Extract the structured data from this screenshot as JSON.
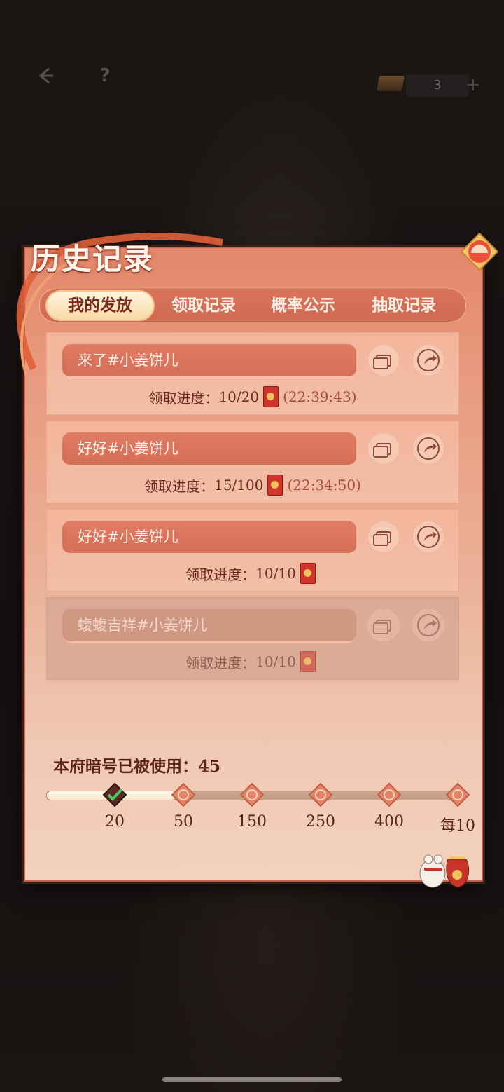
{
  "hud": {
    "resource_count": "3",
    "plus_label": "+"
  },
  "panel": {
    "title": "历史记录"
  },
  "tabs": [
    {
      "label": "我的发放",
      "active": true
    },
    {
      "label": "领取记录",
      "active": false
    },
    {
      "label": "概率公示",
      "active": false
    },
    {
      "label": "抽取记录",
      "active": false
    }
  ],
  "records": [
    {
      "name": "来了#小姜饼儿",
      "progress_label": "领取进度：",
      "progress": "10/20",
      "time": "(22:39:43)",
      "dimmed": false
    },
    {
      "name": "好好#小姜饼儿",
      "progress_label": "领取进度：",
      "progress": "15/100",
      "time": "(22:34:50)",
      "dimmed": false
    },
    {
      "name": "好好#小姜饼儿",
      "progress_label": "领取进度：",
      "progress": "10/10",
      "time": "",
      "dimmed": false
    },
    {
      "name": "蝮蝮吉祥#小姜饼儿",
      "progress_label": "领取进度：",
      "progress": "10/10",
      "time": "",
      "dimmed": true
    }
  ],
  "usage": {
    "label": "本府暗号已被使用：45",
    "count": 45
  },
  "milestones": [
    {
      "label": "20",
      "achieved": true
    },
    {
      "label": "50",
      "achieved": false
    },
    {
      "label": "150",
      "achieved": false
    },
    {
      "label": "250",
      "achieved": false
    },
    {
      "label": "400",
      "achieved": false
    },
    {
      "label": "每10",
      "achieved": false
    }
  ],
  "colors": {
    "accent": "#d56e56",
    "text_dark": "#5a2418",
    "achieved_check": "#4cc66a"
  }
}
